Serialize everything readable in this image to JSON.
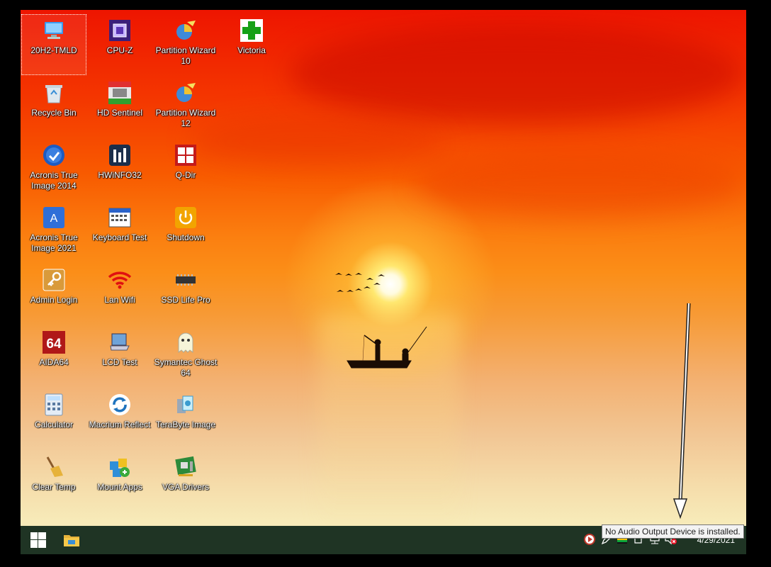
{
  "desktop": {
    "icons": [
      {
        "label": "20H2-TMLD",
        "icon": "this-pc-icon"
      },
      {
        "label": "CPU-Z",
        "icon": "cpu-z-icon"
      },
      {
        "label": "Partition Wizard 10",
        "icon": "partition-wizard-icon"
      },
      {
        "label": "Victoria",
        "icon": "victoria-cross-icon"
      },
      {
        "label": "Recycle Bin",
        "icon": "recycle-bin-icon"
      },
      {
        "label": "HD Sentinel",
        "icon": "hd-sentinel-icon"
      },
      {
        "label": "Partition Wizard 12",
        "icon": "partition-wizard-icon"
      },
      {
        "label": "Acronis True Image 2014",
        "icon": "acronis-2014-icon"
      },
      {
        "label": "HWiNFO32",
        "icon": "hwinfo-icon"
      },
      {
        "label": "Q-Dir",
        "icon": "q-dir-icon"
      },
      {
        "label": "Acronis True Image 2021",
        "icon": "acronis-2021-icon"
      },
      {
        "label": "Keyboard Test",
        "icon": "keyboard-test-icon"
      },
      {
        "label": "Shutdown",
        "icon": "power-icon"
      },
      {
        "label": "Admin Login",
        "icon": "key-icon"
      },
      {
        "label": "Lan Wifi",
        "icon": "wifi-icon"
      },
      {
        "label": "SSD Life Pro",
        "icon": "ssd-chip-icon"
      },
      {
        "label": "AIDA64",
        "icon": "aida64-icon"
      },
      {
        "label": "LCD Test",
        "icon": "laptop-icon"
      },
      {
        "label": "Symantec Ghost 64",
        "icon": "ghost-icon"
      },
      {
        "label": "Calculator",
        "icon": "calculator-icon"
      },
      {
        "label": "Macrium Reflect",
        "icon": "macrium-icon"
      },
      {
        "label": "TeraByte Image",
        "icon": "terabyte-icon"
      },
      {
        "label": "Clear Temp",
        "icon": "broom-icon"
      },
      {
        "label": "Mount Apps",
        "icon": "mount-apps-icon"
      },
      {
        "label": "VGA Drivers",
        "icon": "vga-card-icon"
      }
    ]
  },
  "taskbar": {
    "start_icon": "windows-start-icon",
    "pinned": [
      "file-explorer-icon"
    ],
    "tray_icons": [
      "media-player-icon",
      "pen-icon",
      "flag-icon",
      "display-icon",
      "network-icon",
      "volume-muted-icon"
    ],
    "clock_date": "4/29/2021"
  },
  "tooltip": {
    "text": "No Audio Output Device is installed."
  },
  "colors": {
    "taskbar": "#1f3424",
    "sky_top": "#ee1500",
    "horizon": "#fb8e18",
    "muted_badge": "#e81123"
  }
}
